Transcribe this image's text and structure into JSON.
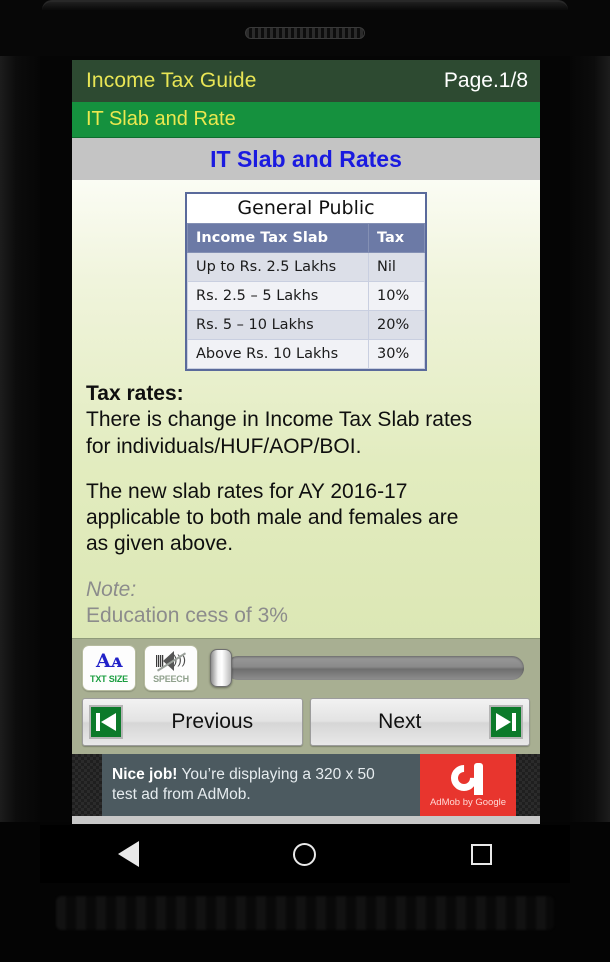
{
  "app": {
    "title": "Income Tax Guide",
    "page_indicator": "Page.1/8",
    "section_title": "IT Slab and Rate",
    "content_heading": "IT Slab and Rates"
  },
  "colors": {
    "titlebar": "#2d4a31",
    "subtitlebar": "#15913e",
    "title_text": "#e8e555",
    "heading_text": "#1a1ae0",
    "toolbar_bg": "#a8af92",
    "table_header": "#6c7aa6",
    "ad_accent": "#e8352e"
  },
  "slab_table": {
    "caption": "General Public",
    "headers": [
      "Income Tax Slab",
      "Tax"
    ],
    "rows": [
      [
        "Up to Rs. 2.5 Lakhs",
        "Nil"
      ],
      [
        "Rs. 2.5 – 5 Lakhs",
        "10%"
      ],
      [
        "Rs. 5 – 10 Lakhs",
        "20%"
      ],
      [
        "Above Rs. 10 Lakhs",
        "30%"
      ]
    ]
  },
  "body": {
    "tax_rates_label": "Tax rates:",
    "para1_line1": "There is change in Income Tax Slab rates",
    "para1_line2": "for individuals/HUF/AOP/BOI.",
    "para2_line1": "The new slab rates for AY 2016-17",
    "para2_line2": "applicable to both male and females are",
    "para2_line3": "as given above.",
    "note_label": "Note:",
    "note_body": "Education cess of 3%"
  },
  "toolbar": {
    "text_size_glyph": "Aᴀ",
    "text_size_label": "TXT SIZE",
    "speech_label": "SPEECH",
    "speech_state": "muted",
    "seek_value": 0
  },
  "navigation": {
    "previous_label": "Previous",
    "next_label": "Next",
    "previous_icon": "skip-previous-icon",
    "next_icon": "skip-next-icon"
  },
  "ad": {
    "headline": "Nice job!",
    "text_line1": " You’re displaying a 320 x 50",
    "text_line2": "test ad from AdMob.",
    "brand_caption": "AdMob by Google"
  },
  "device_nav": {
    "back": "back-triangle",
    "home": "home-circle",
    "recents": "recents-square"
  }
}
